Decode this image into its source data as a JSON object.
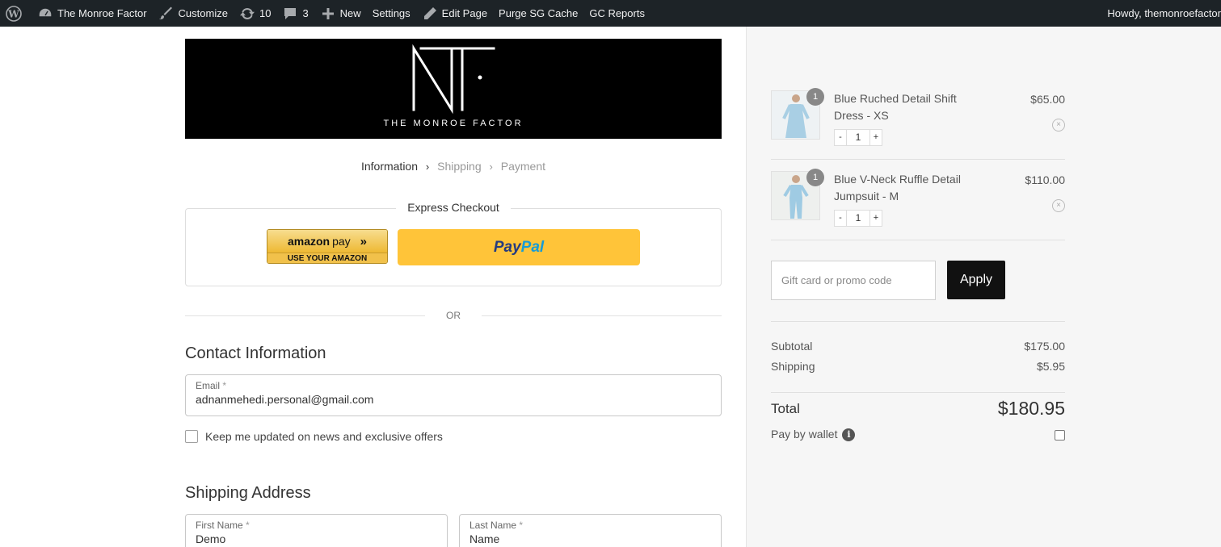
{
  "adminbar": {
    "site_name": "The Monroe Factor",
    "customize": "Customize",
    "updates_count": "10",
    "comments_count": "3",
    "new_label": "New",
    "settings": "Settings",
    "edit_page": "Edit Page",
    "purge_cache": "Purge SG Cache",
    "gc_reports": "GC Reports",
    "howdy": "Howdy, themonroefactor"
  },
  "brand": {
    "monogram": "MF",
    "wordmark": "THE MONROE FACTOR"
  },
  "breadcrumb": {
    "steps": [
      "Information",
      "Shipping",
      "Payment"
    ]
  },
  "express": {
    "title": "Express Checkout",
    "amazon_main": "amazon",
    "amazon_pay": "pay",
    "amazon_chevron": "»",
    "amazon_sub": "USE YOUR AMAZON ACCOUNT",
    "paypal_part1": "Pay",
    "paypal_part2": "Pal"
  },
  "or_text": "OR",
  "contact": {
    "title": "Contact Information",
    "email_label": "Email",
    "required_mark": "*",
    "email_value": "adnanmehedi.personal@gmail.com",
    "newsletter_label": "Keep me updated on news and exclusive offers"
  },
  "shipping": {
    "title": "Shipping Address",
    "first_name_label": "First Name",
    "first_name_value": "Demo",
    "last_name_label": "Last Name",
    "last_name_value": "Name"
  },
  "cart": {
    "items": [
      {
        "name": "Blue Ruched Detail Shift Dress - XS",
        "price": "$65.00",
        "quantity": "1",
        "minus": "-",
        "plus": "+",
        "remove": "×"
      },
      {
        "name": "Blue V-Neck Ruffle Detail Jumpsuit - M",
        "price": "$110.00",
        "quantity": "1",
        "minus": "-",
        "plus": "+",
        "remove": "×"
      }
    ],
    "promo_placeholder": "Gift card or promo code",
    "apply_label": "Apply",
    "subtotal_label": "Subtotal",
    "subtotal_value": "$175.00",
    "shipping_label": "Shipping",
    "shipping_value": "$5.95",
    "total_label": "Total",
    "total_value": "$180.95",
    "wallet_label": "Pay by wallet",
    "info_glyph": "i"
  },
  "colors": {
    "adminbar_bg": "#1d2327",
    "paypal_yellow": "#ffc439",
    "apply_bg": "#111111",
    "summary_bg": "#f6f6f6"
  }
}
